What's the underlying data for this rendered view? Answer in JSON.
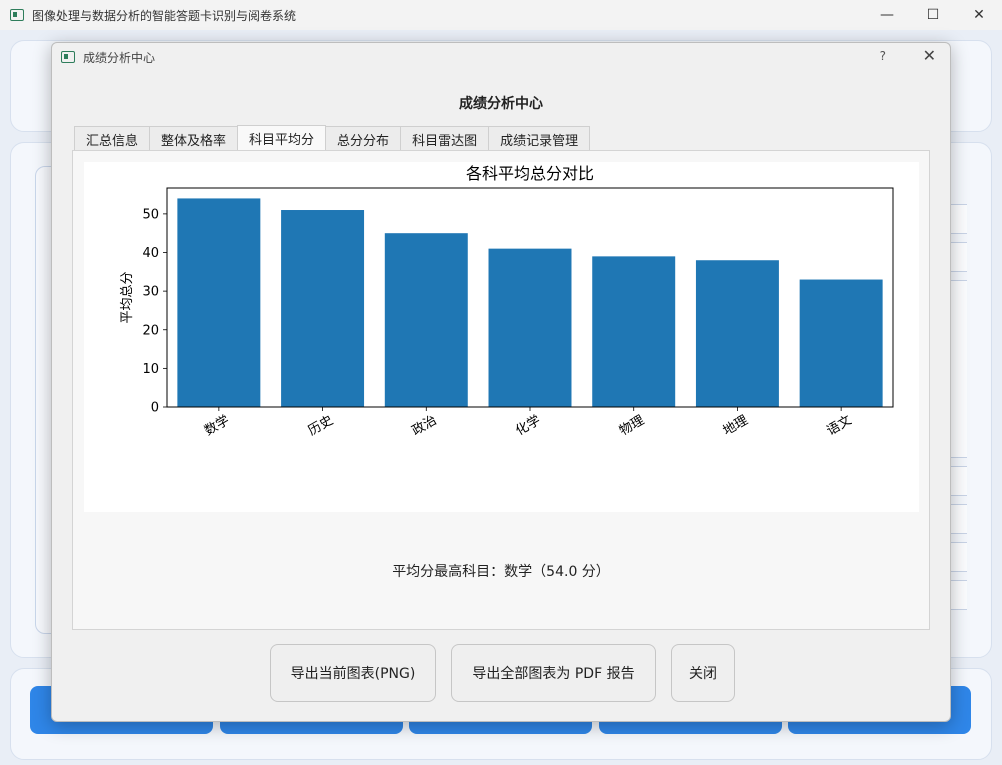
{
  "main_window": {
    "title": "图像处理与数据分析的智能答题卡识别与阅卷系统"
  },
  "dialog": {
    "title": "成绩分析中心",
    "help_label": "?",
    "close_label": "✕",
    "heading": "成绩分析中心",
    "tabs": [
      {
        "label": "汇总信息"
      },
      {
        "label": "整体及格率"
      },
      {
        "label": "科目平均分"
      },
      {
        "label": "总分分布"
      },
      {
        "label": "科目雷达图"
      },
      {
        "label": "成绩记录管理"
      }
    ],
    "active_tab": "科目平均分",
    "summary": "平均分最高科目：数学（54.0 分）",
    "buttons": {
      "export_png": "导出当前图表(PNG)",
      "export_pdf": "导出全部图表为 PDF 报告",
      "close": "关闭"
    }
  },
  "chart_data": {
    "type": "bar",
    "title": "各科平均总分对比",
    "xlabel": "",
    "ylabel": "平均总分",
    "categories": [
      "数学",
      "历史",
      "政治",
      "化学",
      "物理",
      "地理",
      "语文"
    ],
    "values": [
      54,
      51,
      45,
      41,
      39,
      38,
      33
    ],
    "ylim": [
      0,
      56.7
    ],
    "yticks": [
      0,
      10,
      20,
      30,
      40,
      50
    ],
    "bar_color": "#1f77b4",
    "grid": false
  }
}
